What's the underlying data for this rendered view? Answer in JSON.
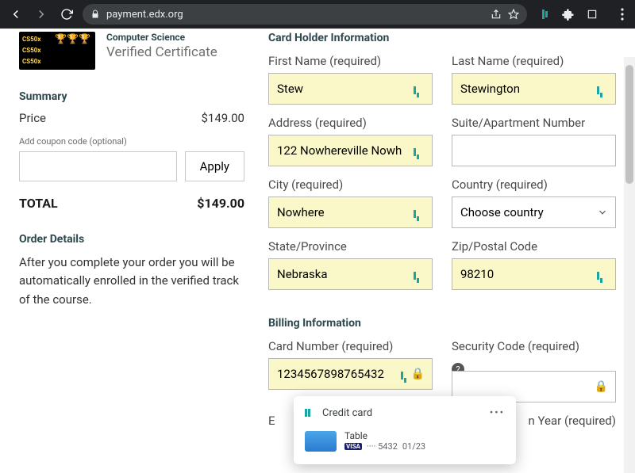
{
  "browser": {
    "url_host": "payment.edx.org"
  },
  "product": {
    "badge": "CS50x",
    "department": "Computer Science",
    "title": "Verified Certificate"
  },
  "summary": {
    "heading": "Summary",
    "price_label": "Price",
    "price_value": "$149.00",
    "coupon_label": "Add coupon code (optional)",
    "apply": "Apply",
    "total_label": "TOTAL",
    "total_value": "$149.00"
  },
  "order_details": {
    "heading": "Order Details",
    "text": "After you complete your order you will be automatically enrolled in the verified track of the course."
  },
  "cardholder": {
    "heading": "Card Holder Information",
    "first_name": {
      "label": "First Name (required)",
      "value": "Stew"
    },
    "last_name": {
      "label": "Last Name (required)",
      "value": "Stewington"
    },
    "address": {
      "label": "Address (required)",
      "value": "122 Nowhereville Nowh"
    },
    "suite": {
      "label": "Suite/Apartment Number",
      "value": ""
    },
    "city": {
      "label": "City (required)",
      "value": "Nowhere"
    },
    "country": {
      "label": "Country (required)",
      "value": "Choose country"
    },
    "state": {
      "label": "State/Province",
      "value": "Nebraska"
    },
    "zip": {
      "label": "Zip/Postal Code",
      "value": "98210"
    }
  },
  "billing": {
    "heading": "Billing Information",
    "card_number": {
      "label": "Card Number (required)",
      "value": "1234567898765432"
    },
    "security": {
      "label": "Security Code (required)",
      "value": ""
    },
    "exp_month_partial": "E",
    "exp_year_partial": "n Year (required)"
  },
  "autofill_popup": {
    "title": "Credit card",
    "card_name": "Table",
    "brand": "VISA",
    "masked": "···· 5432",
    "expiry": "01/23"
  }
}
